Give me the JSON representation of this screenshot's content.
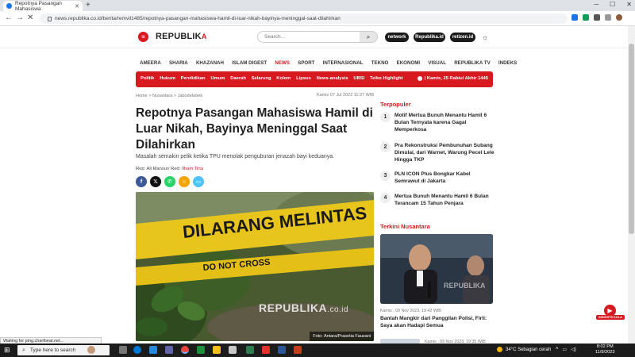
{
  "browser": {
    "tab_title": "Repotnya Pasangan Mahasiswa",
    "url": "news.republika.co.id/berita/remvil1485/repotnya-pasangan-mahasiswa-hamil-di-luar-nikah-bayinya-meninggal-saat-dilahirkan",
    "status": "Waiting for ping.chartbeat.net..."
  },
  "header": {
    "logo_text": "REPUBLIK",
    "logo_suffix": "A",
    "search_placeholder": "Search...",
    "pills": [
      "network",
      "Republika.id",
      "retizen.id"
    ]
  },
  "mainnav": [
    "AMEERA",
    "SHARIA",
    "KHAZANAH",
    "ISLAM DIGEST",
    "NEWS",
    "SPORT",
    "INTERNASIONAL",
    "TEKNO",
    "EKONOMI",
    "VISUAL",
    "REPUBLIKA TV",
    "INDEKS"
  ],
  "active_nav": "NEWS",
  "subnav": {
    "items": [
      "Politik",
      "Hukum",
      "Pendidikan",
      "Umum",
      "Daerah",
      "Selarung",
      "Kolom",
      "Lipsus",
      "News-analysis",
      "UBSI",
      "Teiko Highlight"
    ],
    "date": "| Kamis, 25 Rabiul Akhir 1445"
  },
  "article": {
    "breadcrumb": "Home > Nusantara > Jabodetabek",
    "published": "Kamis 07 Jul 2022 11:37 WIB",
    "title": "Repotnya Pasangan Mahasiswa Hamil di Luar Nikah, Bayinya Meninggal Saat Dilahirkan",
    "summary": "Masalah semakin pelik ketika TPU menolak penguburan jenazah bayi keduanya.",
    "credit_prefix": "Rep: Ali Mansur/ Red: ",
    "credit_editor": "Ilham Tirta",
    "photo_tape_text": "DILARANG MELINTAS",
    "photo_tape_sub": "DO NOT CROSS",
    "photo_watermark": "REPUBLIKA",
    "photo_watermark_suffix": ".co.id",
    "photo_caption": "Foto: Antara/Prasetia Fauzani"
  },
  "sidebar": {
    "popular_heading": "Terpopuler",
    "popular": [
      {
        "num": "1",
        "title": "Motif Mertua Bunuh Menantu Hamil 6 Bulan Ternyata karena Gagal Memperkosa"
      },
      {
        "num": "2",
        "title": "Pra Rekonstruksi Pembunuhan Subang Dimulai, dari Warnet, Warung Pecel Lele Hingga TKP"
      },
      {
        "num": "3",
        "title": "PLN ICON Plus Bongkar Kabel Semrawut di Jakarta"
      },
      {
        "num": "4",
        "title": "Mertua Bunuh Menantu Hamil 6 Bulan Terancam 15 Tahun Penjara"
      }
    ],
    "terkini_heading": "Terkini Nusantara",
    "terkini_watermark": "REPUBLIKA",
    "terkini_meta": "Kamis , 09 Nov 2023, 19:42 WIB",
    "terkini_title": "Bantah Mangkir dari Panggilan Polisi, Firli: Saya akan Hadapi Semua",
    "terkini2_meta": "Kamis , 09 Nov 2023, 19:35 WIB"
  },
  "fab_label": "INSIGHTS KOLA",
  "taskbar": {
    "search_text": "Type here to search",
    "weather": "34°C  Sebagian cerah",
    "time": "8:02 PM",
    "date": "11/9/2023"
  },
  "colors": {
    "brand": "#d71920",
    "dark_pill": "#1a1a1a"
  }
}
